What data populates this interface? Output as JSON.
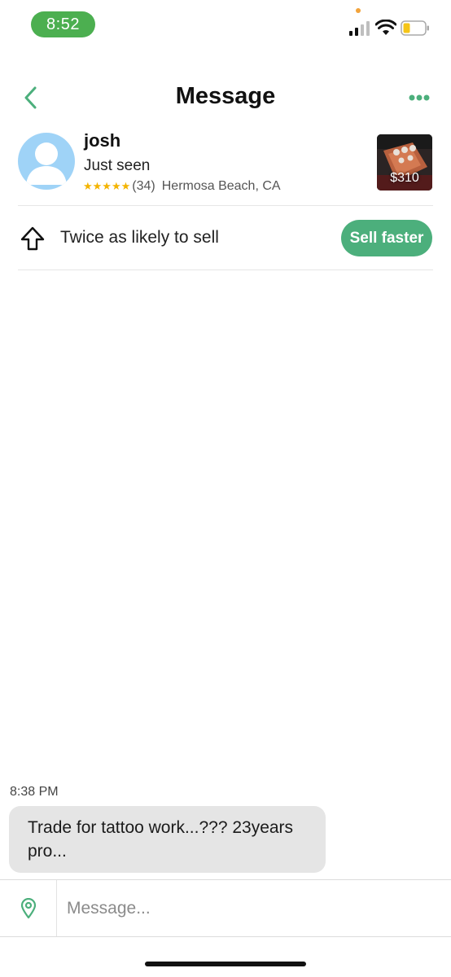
{
  "status_bar": {
    "time": "8:52",
    "icons": [
      "signal-icon",
      "wifi-icon",
      "battery-icon"
    ]
  },
  "header": {
    "title": "Message",
    "back_icon": "chevron-left-icon",
    "more_icon": "more-dots-icon"
  },
  "seller": {
    "name": "josh",
    "status": "Just seen",
    "stars": "★★★★★",
    "rating_count": "(34)",
    "location": "Hermosa Beach, CA"
  },
  "product": {
    "price": "$310"
  },
  "promo": {
    "text": "Twice as likely to sell",
    "button_label": "Sell faster",
    "icon": "arrow-up-outline-icon"
  },
  "messages": [
    {
      "time": "8:38 PM",
      "text": "Trade for tattoo work...??? 23years pro..."
    }
  ],
  "composer": {
    "placeholder": "Message...",
    "location_icon": "location-pin-icon"
  },
  "colors": {
    "accent": "#4caf7c",
    "status_pill": "#4caf50",
    "avatar_bg": "#9fd3f7",
    "star": "#f4b400",
    "bubble_bg": "#e5e5e5"
  }
}
